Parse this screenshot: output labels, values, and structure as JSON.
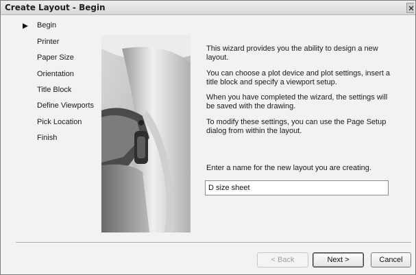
{
  "window": {
    "title": "Create Layout - Begin"
  },
  "steps": {
    "current": "Begin",
    "items": [
      {
        "label": "Begin"
      },
      {
        "label": "Printer"
      },
      {
        "label": "Paper Size"
      },
      {
        "label": "Orientation"
      },
      {
        "label": "Title Block"
      },
      {
        "label": "Define Viewports"
      },
      {
        "label": "Pick Location"
      },
      {
        "label": "Finish"
      }
    ]
  },
  "content": {
    "paragraphs": [
      "This wizard provides you the ability to design a new layout.",
      "You can choose a plot device and plot settings, insert a title block and specify a viewport setup.",
      "When you have completed the wizard, the settings will be saved with the drawing.",
      "To modify these settings, you can use the Page Setup dialog from within the layout."
    ],
    "name_prompt": "Enter a name for the new layout you are creating.",
    "name_value": "D size sheet"
  },
  "buttons": {
    "back": "< Back",
    "next": "Next >",
    "cancel": "Cancel"
  }
}
